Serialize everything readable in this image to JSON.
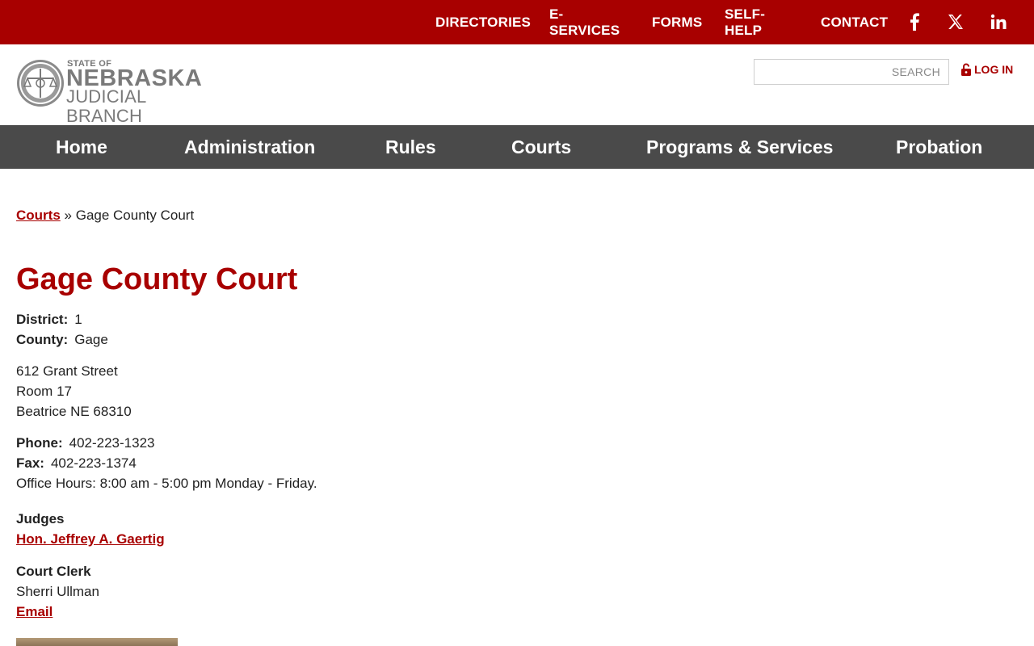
{
  "topnav": {
    "items": [
      "DIRECTORIES",
      "E-SERVICES",
      "FORMS",
      "SELF-HELP",
      "CONTACT"
    ],
    "social": [
      "facebook-icon",
      "x-icon",
      "linkedin-icon"
    ]
  },
  "header": {
    "logo": {
      "line1": "STATE OF",
      "line2": "NEBRASKA",
      "line3": "JUDICIAL BRANCH"
    },
    "search_placeholder": "SEARCH",
    "login_label": "LOG IN"
  },
  "mainnav": {
    "items": [
      "Home",
      "Administration",
      "Rules",
      "Courts",
      "Programs & Services",
      "Probation"
    ]
  },
  "breadcrumb": {
    "link": "Courts",
    "separator": "»",
    "current": "Gage County Court"
  },
  "page": {
    "title": "Gage County Court",
    "district_label": "District:",
    "district_value": "1",
    "county_label": "County:",
    "county_value": "Gage",
    "address": [
      "612 Grant Street",
      "Room 17",
      "Beatrice NE 68310"
    ],
    "phone_label": "Phone:",
    "phone_value": "402-223-1323",
    "fax_label": "Fax:",
    "fax_value": "402-223-1374",
    "hours": "Office Hours: 8:00 am - 5:00 pm Monday - Friday.",
    "judges_title": "Judges",
    "judge_name": "Hon. Jeffrey A. Gaertig",
    "clerk_title": "Court Clerk",
    "clerk_name": "Sherri Ullman",
    "clerk_email_label": "Email"
  },
  "colors": {
    "brand_red": "#a80000",
    "nav_gray": "#4a4a4a",
    "logo_gray": "#7a7a7a"
  }
}
